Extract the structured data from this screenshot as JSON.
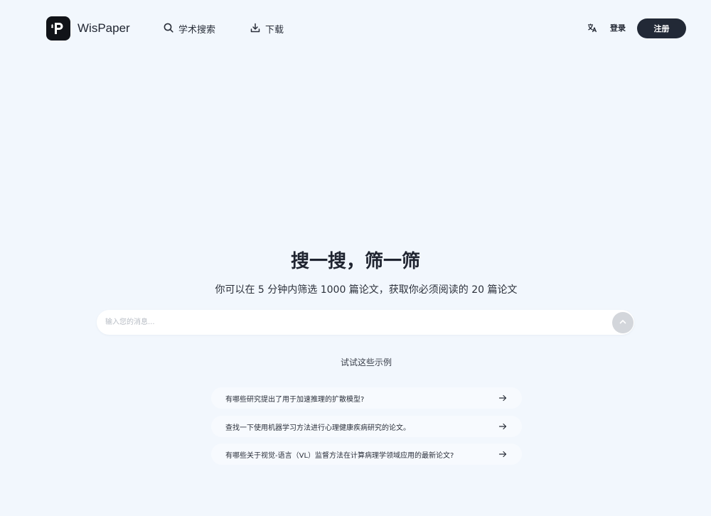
{
  "header": {
    "logo_text": "WisPaper",
    "nav": {
      "search_label": "学术搜索",
      "download_label": "下载"
    },
    "lang_icon": "translate-icon",
    "login_label": "登录",
    "signup_label": "注册"
  },
  "hero": {
    "title": "搜一搜，筛一筛",
    "subtitle": "你可以在 5 分钟内筛选 1000 篇论文，获取你必须阅读的 20 篇论文"
  },
  "search": {
    "placeholder": "输入您的消息...",
    "value": "",
    "send_icon": "arrow-up-icon"
  },
  "examples": {
    "heading": "试试这些示例",
    "items": [
      "有哪些研究提出了用于加速推理的扩散模型?",
      "查找一下使用机器学习方法进行心理健康疾病研究的论文。",
      "有哪些关于视觉-语言（VL）监督方法在计算病理学领域应用的最新论文?"
    ]
  },
  "colors": {
    "background": "#f2f7fd",
    "primary_button": "#222936",
    "send_button": "#d3d6db"
  }
}
